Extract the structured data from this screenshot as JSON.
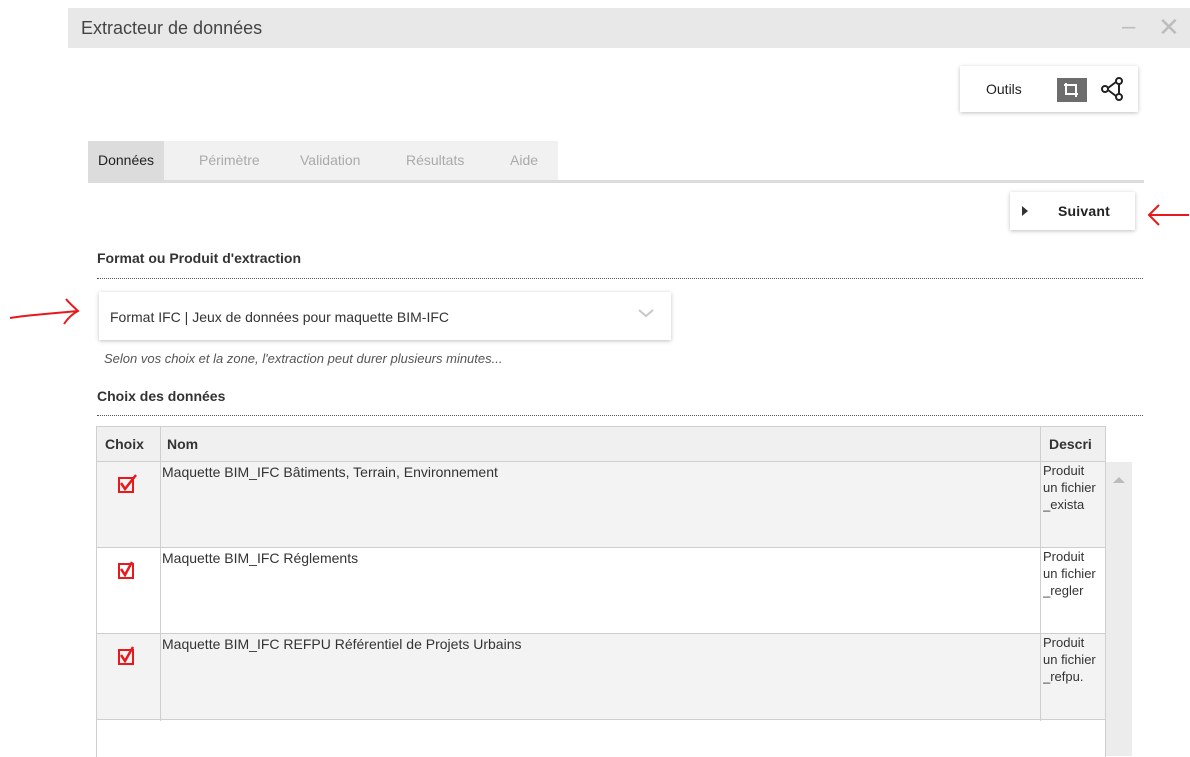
{
  "window": {
    "title": "Extracteur de données",
    "minimize_glyph": "–",
    "close_glyph": "✕"
  },
  "tools": {
    "label": "Outils",
    "icons": [
      "crop-icon",
      "share-icon"
    ]
  },
  "tabs": [
    {
      "label": "Données",
      "active": true
    },
    {
      "label": "Périmètre",
      "active": false
    },
    {
      "label": "Validation",
      "active": false
    },
    {
      "label": "Résultats",
      "active": false
    },
    {
      "label": "Aide",
      "active": false
    }
  ],
  "next_button": {
    "label": "Suivant"
  },
  "format_section": {
    "title": "Format ou Produit d'extraction",
    "selected": "Format IFC | Jeux de données pour maquette BIM-IFC",
    "hint": "Selon vos choix et la zone, l'extraction peut durer plusieurs minutes..."
  },
  "data_section": {
    "title": "Choix des données",
    "columns": [
      "Choix",
      "Nom",
      "Descri"
    ],
    "rows": [
      {
        "checked": true,
        "name": "Maquette BIM_IFC Bâtiments, Terrain, Environnement",
        "desc": "Produit un fichier _exista"
      },
      {
        "checked": true,
        "name": "Maquette BIM_IFC Réglements",
        "desc": "Produit un fichier _regler"
      },
      {
        "checked": true,
        "name": "Maquette BIM_IFC REFPU Référentiel de Projets Urbains",
        "desc": "Produit un fichier _refpu."
      }
    ]
  },
  "colors": {
    "accent_red": "#e8191c",
    "titlebar_bg": "#e8e8e8",
    "active_tab_bg": "#dcdcdc"
  }
}
